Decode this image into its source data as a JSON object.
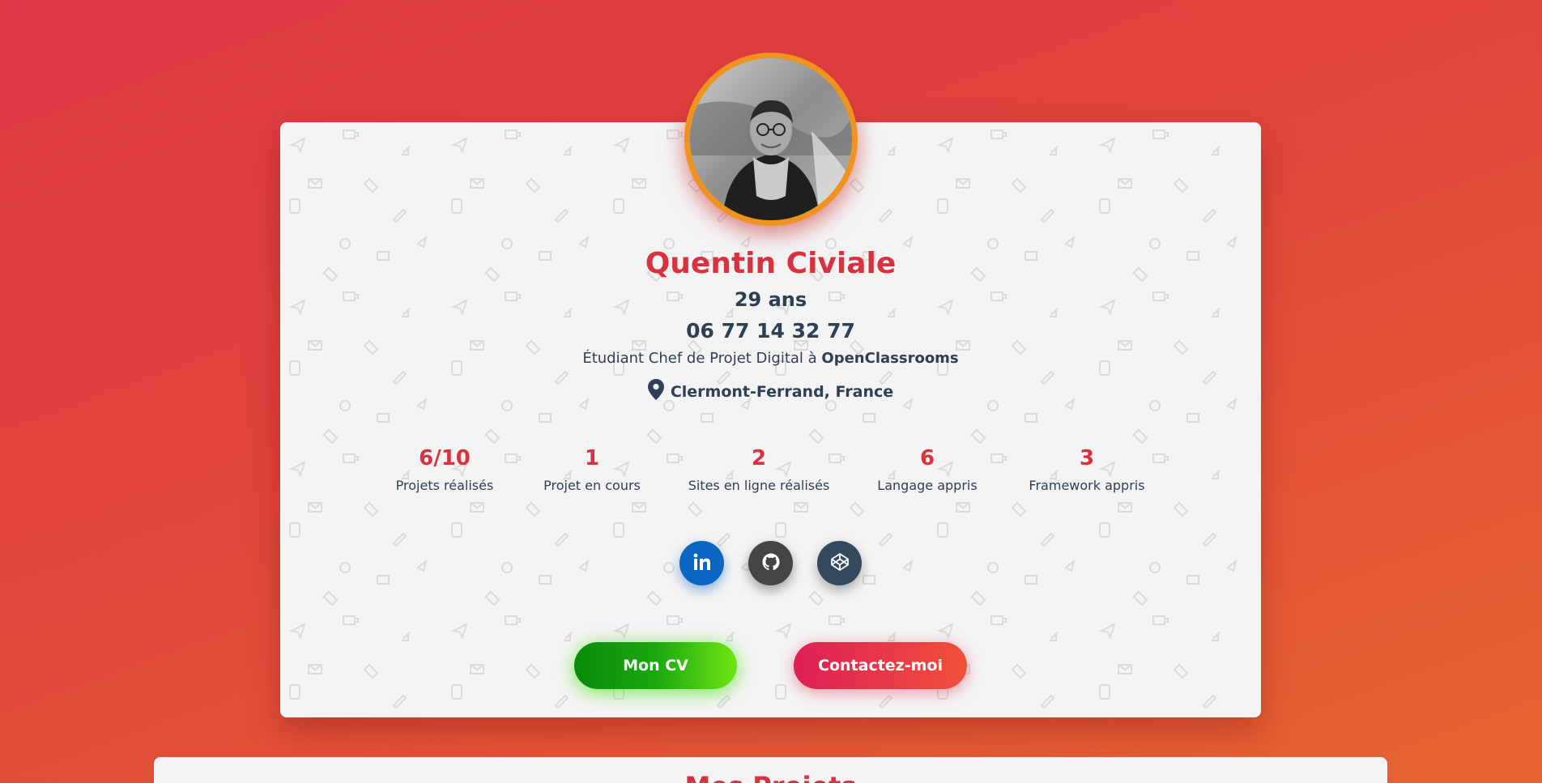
{
  "profile": {
    "name": "Quentin Civiale",
    "age": "29 ans",
    "phone": "06 77 14 32 77",
    "role_prefix": "Étudiant Chef de Projet Digital à ",
    "role_org": "OpenClassrooms",
    "location": "Clermont-Ferrand, France"
  },
  "stats": [
    {
      "value": "6/10",
      "label": "Projets réalisés"
    },
    {
      "value": "1",
      "label": "Projet en cours"
    },
    {
      "value": "2",
      "label": "Sites en ligne réalisés"
    },
    {
      "value": "6",
      "label": "Langage appris"
    },
    {
      "value": "3",
      "label": "Framework appris"
    }
  ],
  "socials": [
    {
      "name": "linkedin",
      "icon": "linkedin-icon"
    },
    {
      "name": "github",
      "icon": "github-icon"
    },
    {
      "name": "codepen",
      "icon": "codepen-icon"
    }
  ],
  "buttons": {
    "cv_label": "Mon CV",
    "contact_label": "Contactez-moi"
  },
  "next_section": {
    "title": "Mes Projets"
  },
  "colors": {
    "accent": "#d9323f",
    "text": "#2f3f55",
    "avatar_ring": "#f0921e",
    "linkedin": "#0a66c2",
    "github": "#444444",
    "codepen": "#34495e"
  }
}
